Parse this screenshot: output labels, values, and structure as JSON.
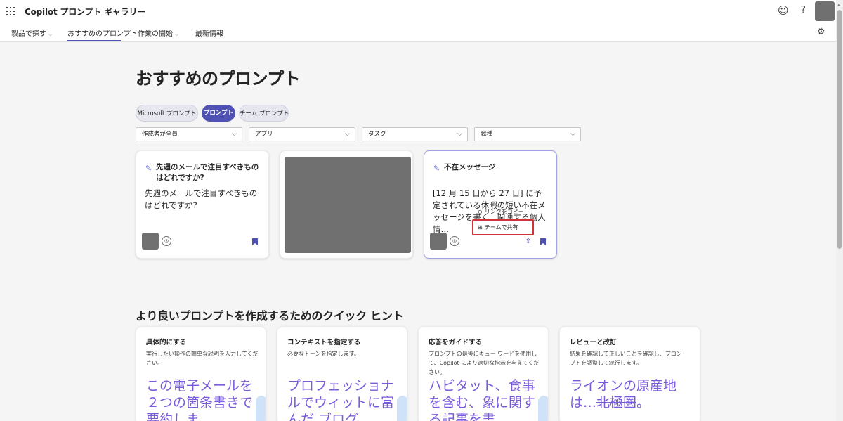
{
  "header": {
    "app_title": "Copilot プロンプト ギャラリー",
    "help": "?"
  },
  "nav": {
    "items": [
      {
        "label": "製品で探す",
        "has_chevron": true
      },
      {
        "label": "おすすめのプロンプト",
        "has_chevron": false,
        "active": true
      },
      {
        "label": "作業の開始",
        "has_chevron": true
      },
      {
        "label": "最新情報",
        "has_chevron": false
      }
    ]
  },
  "main": {
    "page_title": "おすすめのプロンプト",
    "filter_tabs": [
      {
        "label": "Microsoft プロンプト",
        "selected": false
      },
      {
        "label": "プロンプト",
        "selected": true
      },
      {
        "label": "チーム プロンプト",
        "selected": false
      }
    ],
    "dropdowns": [
      {
        "value": "作成者が全員"
      },
      {
        "value": "アプリ"
      },
      {
        "value": "タスク"
      },
      {
        "value": "職種"
      }
    ],
    "cards": [
      {
        "title": "先週のメールで注目すべきものはどれですか?",
        "body": "先週のメールで注目すべきものはどれですか?"
      },
      {
        "title": "不在メッセージ",
        "body": "[12 月 15 日から 27 日] に予定されている休暇の短い不在メッセージを書く…関連する個人情…"
      }
    ],
    "context_menu": {
      "items": [
        {
          "label": "リンクをコピー",
          "icon": "link-icon"
        },
        {
          "label": "チームで共有",
          "icon": "teams-icon"
        }
      ]
    }
  },
  "tips": {
    "section_title": "より良いプロンプトを作成するためのクイック ヒント",
    "items": [
      {
        "title": "具体的にする",
        "desc": "実行したい操作の簡単な説明を入力してください。",
        "example": "この電子メールを２つの箇条書きで要約しま"
      },
      {
        "title": "コンテキストを指定する",
        "desc": "必要なトーンを指定します。",
        "example": "プロフェッショナルでウィットに富んだ ブログ"
      },
      {
        "title": "応答をガイドする",
        "desc": "プロンプトの最後にキュー ワードを使用して、Copilot により適切な指示を与えてください。",
        "example": "ハビタット、食事を含む、象に関する記事を書"
      },
      {
        "title": "レビューと改訂",
        "desc": "結果を確認して正しいことを確認し、プロンプトを調整して続行します。",
        "example_prefix": "ライオンの原産地は…",
        "example_strike": "北極圏",
        "example_suffix": "。"
      }
    ]
  },
  "colors": {
    "accent": "#4f52b2",
    "tip_example": "#7a5bdc",
    "highlight_red": "#d13438"
  }
}
